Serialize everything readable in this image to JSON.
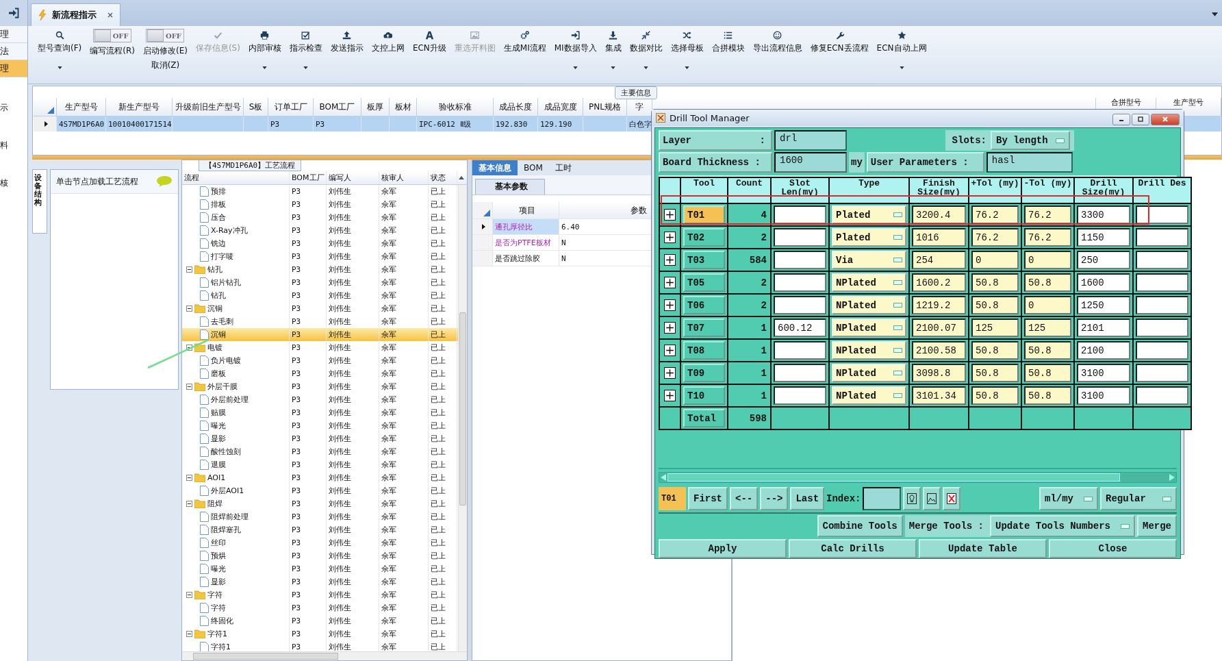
{
  "side_strip": {
    "items": [
      {
        "label": "理",
        "selected": false
      },
      {
        "label": "法",
        "selected": false
      },
      {
        "label": "理",
        "selected": true
      }
    ],
    "notes": [
      "示",
      "料",
      "核"
    ]
  },
  "tabs": [
    {
      "label": "新流程指示",
      "selected": true
    }
  ],
  "toolbar": [
    {
      "kind": "button",
      "label": "型号查询(F)",
      "disabled": false,
      "dropdown": true
    },
    {
      "kind": "toggle",
      "toggle_text": "OFF",
      "on": false,
      "label": "编写流程(R)"
    },
    {
      "kind": "toggle",
      "toggle_text": "OFF",
      "on": false,
      "label": "启动修改(E)",
      "label2": "取消(Z)"
    },
    {
      "kind": "button",
      "label": "保存信息(S)",
      "disabled": true,
      "dropdown": false
    },
    {
      "kind": "button",
      "label": "内部审核",
      "disabled": false,
      "dropdown": true
    },
    {
      "kind": "button",
      "label": "指示检查",
      "disabled": false,
      "dropdown": true
    },
    {
      "kind": "button",
      "label": "发送指示",
      "disabled": false,
      "dropdown": false
    },
    {
      "kind": "button",
      "label": "文控上网",
      "disabled": false,
      "dropdown": false
    },
    {
      "kind": "button",
      "label": "ECN升级",
      "disabled": false,
      "dropdown": false
    },
    {
      "kind": "button",
      "label": "重选开料图",
      "disabled": true,
      "dropdown": false
    },
    {
      "kind": "button",
      "label": "生成MI流程",
      "disabled": false,
      "dropdown": false
    },
    {
      "kind": "button",
      "label": "MI数据导入",
      "disabled": false,
      "dropdown": true
    },
    {
      "kind": "button",
      "label": "集成",
      "disabled": false,
      "dropdown": true
    },
    {
      "kind": "button",
      "label": "数据对比",
      "disabled": false,
      "dropdown": true
    },
    {
      "kind": "button",
      "label": "选择母板",
      "disabled": false,
      "dropdown": true
    },
    {
      "kind": "button",
      "label": "合拼模块",
      "disabled": false,
      "dropdown": false
    },
    {
      "kind": "button",
      "label": "导出流程信息",
      "disabled": false,
      "dropdown": false
    },
    {
      "kind": "button",
      "label": "修复ECN丢流程",
      "disabled": false,
      "dropdown": false
    },
    {
      "kind": "button",
      "label": "ECN自动上网",
      "disabled": false,
      "dropdown": true
    }
  ],
  "main_info": {
    "title": "主要信息",
    "columns": [
      "生产型号",
      "新生产型号",
      "升级前旧生产型号",
      "S板",
      "订单工厂",
      "BOM工厂",
      "板厚",
      "板材",
      "验收标准",
      "成品长度",
      "成品宽度",
      "PNL规格",
      "字",
      "合拼型号",
      "生产型号"
    ],
    "rows": [
      {
        "selected": true,
        "cells": [
          "4S7MD1P6A0",
          "10010400171514",
          null,
          null,
          "P3",
          "P3",
          null,
          null,
          "IPC-6012 Ⅱ级",
          "192.830",
          "129.190",
          null,
          "白色字",
          null,
          null
        ]
      }
    ]
  },
  "side_panel": {
    "tab": "设备结构",
    "hint": "单击节点加载工艺流程"
  },
  "process_flow": {
    "title": "【4S7MD1P6A0】工艺流程",
    "columns": [
      "流程",
      "BOM工厂",
      "编写人",
      "核审人",
      "状态"
    ],
    "tree": [
      {
        "label": "预排",
        "bom": "P3",
        "writer": "刘伟生",
        "reviewer": "佘军",
        "status": "已上",
        "selected": false
      },
      {
        "label": "排板",
        "bom": "P3",
        "writer": "刘伟生",
        "reviewer": "佘军",
        "status": "已上",
        "selected": false
      },
      {
        "label": "压合",
        "bom": "P3",
        "writer": "刘伟生",
        "reviewer": "佘军",
        "status": "已上",
        "selected": false
      },
      {
        "label": "X-Ray冲孔",
        "bom": "P3",
        "writer": "刘伟生",
        "reviewer": "佘军",
        "status": "已上",
        "selected": false
      },
      {
        "label": "铣边",
        "bom": "P3",
        "writer": "刘伟生",
        "reviewer": "佘军",
        "status": "已上",
        "selected": false
      },
      {
        "label": "打字唛",
        "bom": "P3",
        "writer": "刘伟生",
        "reviewer": "佘军",
        "status": "已上",
        "selected": false
      },
      {
        "label": "钻孔",
        "bom": "P3",
        "writer": "刘伟生",
        "reviewer": "佘军",
        "status": "已上",
        "selected": false,
        "expanded": true,
        "children": [
          {
            "label": "铝片钻孔",
            "bom": "P3",
            "writer": "刘伟生",
            "reviewer": "佘军",
            "status": "已上",
            "selected": false
          },
          {
            "label": "钻孔",
            "bom": "P3",
            "writer": "刘伟生",
            "reviewer": "佘军",
            "status": "已上",
            "selected": false
          }
        ]
      },
      {
        "label": "沉铜",
        "bom": "P3",
        "writer": "刘伟生",
        "reviewer": "佘军",
        "status": "已上",
        "selected": false,
        "expanded": true,
        "children": [
          {
            "label": "去毛刺",
            "bom": "P3",
            "writer": "刘伟生",
            "reviewer": "佘军",
            "status": "已上",
            "selected": false
          },
          {
            "label": "沉铜",
            "bom": "P3",
            "writer": "刘伟生",
            "reviewer": "佘军",
            "status": "已上",
            "selected": true
          }
        ]
      },
      {
        "label": "电镀",
        "bom": "P3",
        "writer": "刘伟生",
        "reviewer": "佘军",
        "status": "已上",
        "selected": false,
        "expanded": true,
        "children": [
          {
            "label": "负片电镀",
            "bom": "P3",
            "writer": "刘伟生",
            "reviewer": "佘军",
            "status": "已上",
            "selected": false
          },
          {
            "label": "磨板",
            "bom": "P3",
            "writer": "刘伟生",
            "reviewer": "佘军",
            "status": "已上",
            "selected": false
          }
        ]
      },
      {
        "label": "外层干膜",
        "bom": "P3",
        "writer": "刘伟生",
        "reviewer": "佘军",
        "status": "已上",
        "selected": false,
        "expanded": true,
        "children": [
          {
            "label": "外层前处理",
            "bom": "P3",
            "writer": "刘伟生",
            "reviewer": "佘军",
            "status": "已上",
            "selected": false
          },
          {
            "label": "贴膜",
            "bom": "P3",
            "writer": "刘伟生",
            "reviewer": "佘军",
            "status": "已上",
            "selected": false
          },
          {
            "label": "曝光",
            "bom": "P3",
            "writer": "刘伟生",
            "reviewer": "佘军",
            "status": "已上",
            "selected": false
          },
          {
            "label": "显影",
            "bom": "P3",
            "writer": "刘伟生",
            "reviewer": "佘军",
            "status": "已上",
            "selected": false
          },
          {
            "label": "酸性蚀刻",
            "bom": "P3",
            "writer": "刘伟生",
            "reviewer": "佘军",
            "status": "已上",
            "selected": false
          },
          {
            "label": "退膜",
            "bom": "P3",
            "writer": "刘伟生",
            "reviewer": "佘军",
            "status": "已上",
            "selected": false
          }
        ]
      },
      {
        "label": "AOI1",
        "bom": "P3",
        "writer": "刘伟生",
        "reviewer": "佘军",
        "status": "已上",
        "selected": false,
        "expanded": true,
        "children": [
          {
            "label": "外层AOI1",
            "bom": "P3",
            "writer": "刘伟生",
            "reviewer": "佘军",
            "status": "已上",
            "selected": false
          }
        ]
      },
      {
        "label": "阻焊",
        "bom": "P3",
        "writer": "刘伟生",
        "reviewer": "佘军",
        "status": "已上",
        "selected": false,
        "expanded": true,
        "children": [
          {
            "label": "阻焊前处理",
            "bom": "P3",
            "writer": "刘伟生",
            "reviewer": "佘军",
            "status": "已上",
            "selected": false
          },
          {
            "label": "阻焊塞孔",
            "bom": "P3",
            "writer": "刘伟生",
            "reviewer": "佘军",
            "status": "已上",
            "selected": false
          },
          {
            "label": "丝印",
            "bom": "P3",
            "writer": "刘伟生",
            "reviewer": "佘军",
            "status": "已上",
            "selected": false
          },
          {
            "label": "预烘",
            "bom": "P3",
            "writer": "刘伟生",
            "reviewer": "佘军",
            "status": "已上",
            "selected": false
          },
          {
            "label": "曝光",
            "bom": "P3",
            "writer": "刘伟生",
            "reviewer": "佘军",
            "status": "已上",
            "selected": false
          },
          {
            "label": "显影",
            "bom": "P3",
            "writer": "刘伟生",
            "reviewer": "佘军",
            "status": "已上",
            "selected": false
          }
        ]
      },
      {
        "label": "字符",
        "bom": "P3",
        "writer": "刘伟生",
        "reviewer": "佘军",
        "status": "已上",
        "selected": false,
        "expanded": true,
        "children": [
          {
            "label": "字符",
            "bom": "P3",
            "writer": "刘伟生",
            "reviewer": "佘军",
            "status": "已上",
            "selected": false
          },
          {
            "label": "终固化",
            "bom": "P3",
            "writer": "刘伟生",
            "reviewer": "佘军",
            "status": "已上",
            "selected": false
          }
        ]
      },
      {
        "label": "字符1",
        "bom": "P3",
        "writer": "刘伟生",
        "reviewer": "佘军",
        "status": "已上",
        "selected": false,
        "expanded": true,
        "children": [
          {
            "label": "字符1",
            "bom": "P3",
            "writer": "刘伟生",
            "reviewer": "佘军",
            "status": "已上",
            "selected": false
          }
        ]
      }
    ]
  },
  "detail": {
    "tabs": [
      {
        "label": "基本信息",
        "selected": true
      },
      {
        "label": "BOM",
        "selected": false
      },
      {
        "label": "工时",
        "selected": false
      }
    ],
    "subtab": "基本参数",
    "columns": [
      "项目",
      "参数"
    ],
    "rows": [
      {
        "item": "通孔厚径比",
        "value": "6.40",
        "selected": true,
        "highlighted": true
      },
      {
        "item": "是否为PTFE板材",
        "value": "N",
        "selected": false,
        "highlighted": true
      },
      {
        "item": "是否跳过除胶",
        "value": "N",
        "selected": false,
        "highlighted": false
      }
    ]
  },
  "drill_dialog": {
    "title": "Drill Tool Manager",
    "layer_label": "Layer",
    "layer_sep": ":",
    "layer": "drl",
    "slots_label": "Slots:",
    "slots": "By length",
    "thickness_label": "Board Thickness :",
    "thickness": "1600",
    "thickness_unit": "my",
    "user_params_label": "User Parameters :",
    "user_params": "hasl",
    "columns": [
      "Tool",
      "Count",
      "Slot Len(my)",
      "Type",
      "Finish Size(my)",
      "+Tol (my)",
      "-Tol (my)",
      "Drill Size(my)",
      "Drill Des"
    ],
    "tools": [
      {
        "tool": "T01",
        "count": "4",
        "type": "Plated",
        "finish": "3200.4",
        "plus_tol": "76.2",
        "minus_tol": "76.2",
        "drill": "3300",
        "selected": true
      },
      {
        "tool": "T02",
        "count": "2",
        "type": "Plated",
        "finish": "1016",
        "plus_tol": "76.2",
        "minus_tol": "76.2",
        "drill": "1150",
        "selected": false
      },
      {
        "tool": "T03",
        "count": "584",
        "type": "Via",
        "finish": "254",
        "plus_tol": "0",
        "minus_tol": "0",
        "drill": "250",
        "selected": false
      },
      {
        "tool": "T05",
        "count": "2",
        "type": "NPlated",
        "finish": "1600.2",
        "plus_tol": "50.8",
        "minus_tol": "50.8",
        "drill": "1600",
        "selected": false
      },
      {
        "tool": "T06",
        "count": "2",
        "type": "NPlated",
        "finish": "1219.2",
        "plus_tol": "50.8",
        "minus_tol": "0",
        "drill": "1250",
        "selected": false
      },
      {
        "tool": "T07",
        "count": "1",
        "slot_len": "600.12",
        "type": "NPlated",
        "finish": "2100.07",
        "plus_tol": "125",
        "minus_tol": "125",
        "drill": "2101",
        "selected": false
      },
      {
        "tool": "T08",
        "count": "1",
        "type": "NPlated",
        "finish": "2100.58",
        "plus_tol": "50.8",
        "minus_tol": "50.8",
        "drill": "2100",
        "selected": false
      },
      {
        "tool": "T09",
        "count": "1",
        "type": "NPlated",
        "finish": "3098.8",
        "plus_tol": "50.8",
        "minus_tol": "50.8",
        "drill": "3100",
        "selected": false
      },
      {
        "tool": "T10",
        "count": "1",
        "type": "NPlated",
        "finish": "3101.34",
        "plus_tol": "50.8",
        "minus_tol": "50.8",
        "drill": "3100",
        "selected": false
      }
    ],
    "total_label": "Total",
    "total": "598",
    "current": "T01",
    "nav": [
      "First",
      "<--",
      "-->",
      "Last"
    ],
    "index_label": "Index:",
    "units": "ml/my",
    "mode": "Regular",
    "combine": "Combine Tools",
    "merge_label": "Merge Tools :",
    "merge_mode": "Update Tools Numbers",
    "merge": "Merge",
    "actions": [
      "Apply",
      "Calc Drills",
      "Update Table",
      "Close"
    ]
  }
}
